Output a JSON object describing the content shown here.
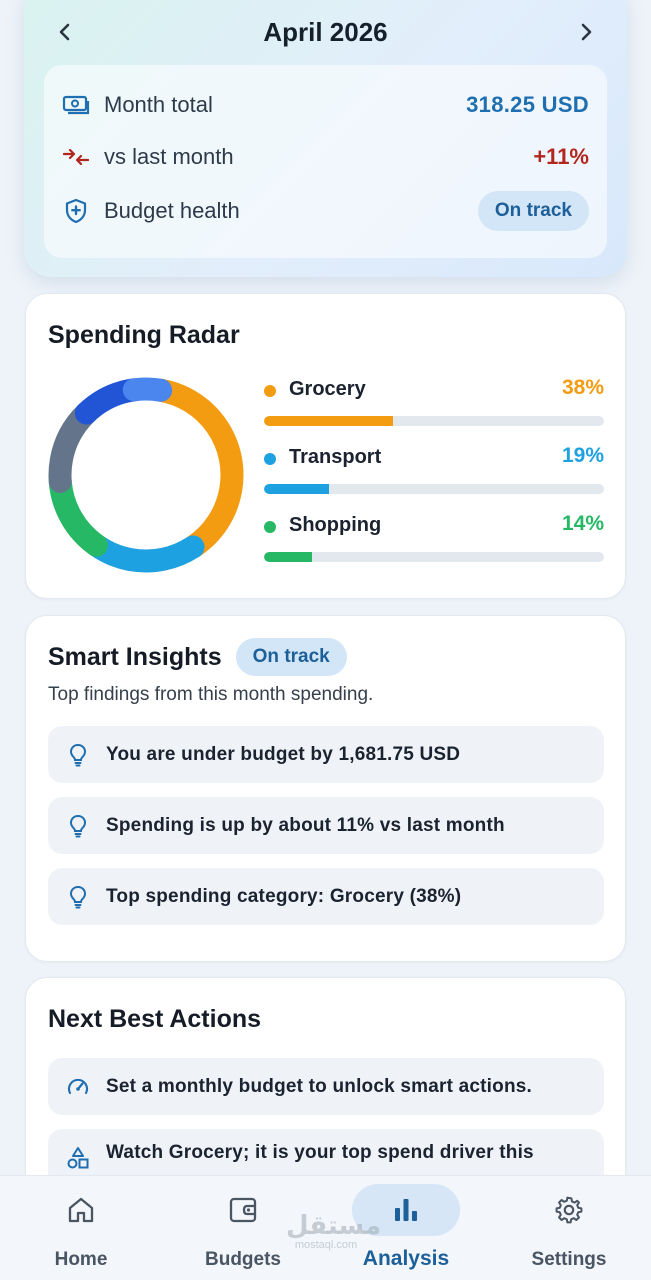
{
  "header": {
    "month": "April 2026",
    "prev_icon": "chevron-left-icon",
    "next_icon": "chevron-right-icon"
  },
  "summary": {
    "month_total_label": "Month total",
    "month_total_value": "318.25 USD",
    "vs_label": "vs last month",
    "vs_value": "+11%",
    "health_label": "Budget health",
    "health_value": "On track"
  },
  "radar": {
    "title": "Spending Radar",
    "items": [
      {
        "name": "Grocery",
        "pct": "38%",
        "fraction": 0.38,
        "color": "#f39c12"
      },
      {
        "name": "Transport",
        "pct": "19%",
        "fraction": 0.19,
        "color": "#1ea1e0"
      },
      {
        "name": "Shopping",
        "pct": "14%",
        "fraction": 0.14,
        "color": "#27b866"
      }
    ],
    "donut_segments": [
      {
        "fraction": 0.38,
        "color": "#f39c12"
      },
      {
        "fraction": 0.19,
        "color": "#1ea1e0"
      },
      {
        "fraction": 0.14,
        "color": "#27b866"
      },
      {
        "fraction": 0.14,
        "color": "#64748b"
      },
      {
        "fraction": 0.1,
        "color": "#2155d6"
      },
      {
        "fraction": 0.05,
        "color": "#4a86ee"
      }
    ]
  },
  "insights": {
    "title": "Smart Insights",
    "status": "On track",
    "subtitle": "Top findings from this month spending.",
    "items": [
      "You are under budget by 1,681.75 USD",
      "Spending is up by about 11% vs last month",
      "Top spending category: Grocery (38%)"
    ]
  },
  "actions": {
    "title": "Next Best Actions",
    "items": [
      "Set a monthly budget to unlock smart actions.",
      "Watch Grocery; it is your top spend driver this"
    ]
  },
  "nav": {
    "items": [
      {
        "label": "Home",
        "icon": "home-icon"
      },
      {
        "label": "Budgets",
        "icon": "wallet-icon"
      },
      {
        "label": "Analysis",
        "icon": "bar-chart-icon",
        "active": true
      },
      {
        "label": "Settings",
        "icon": "gear-icon"
      }
    ]
  },
  "watermark": {
    "arabic": "مستقل",
    "latin": "mostaql.com"
  },
  "colors": {
    "accent": "#1d5f99",
    "total": "#1f6fb0",
    "negative": "#b3261e",
    "pill_bg": "#d3e6f7"
  }
}
